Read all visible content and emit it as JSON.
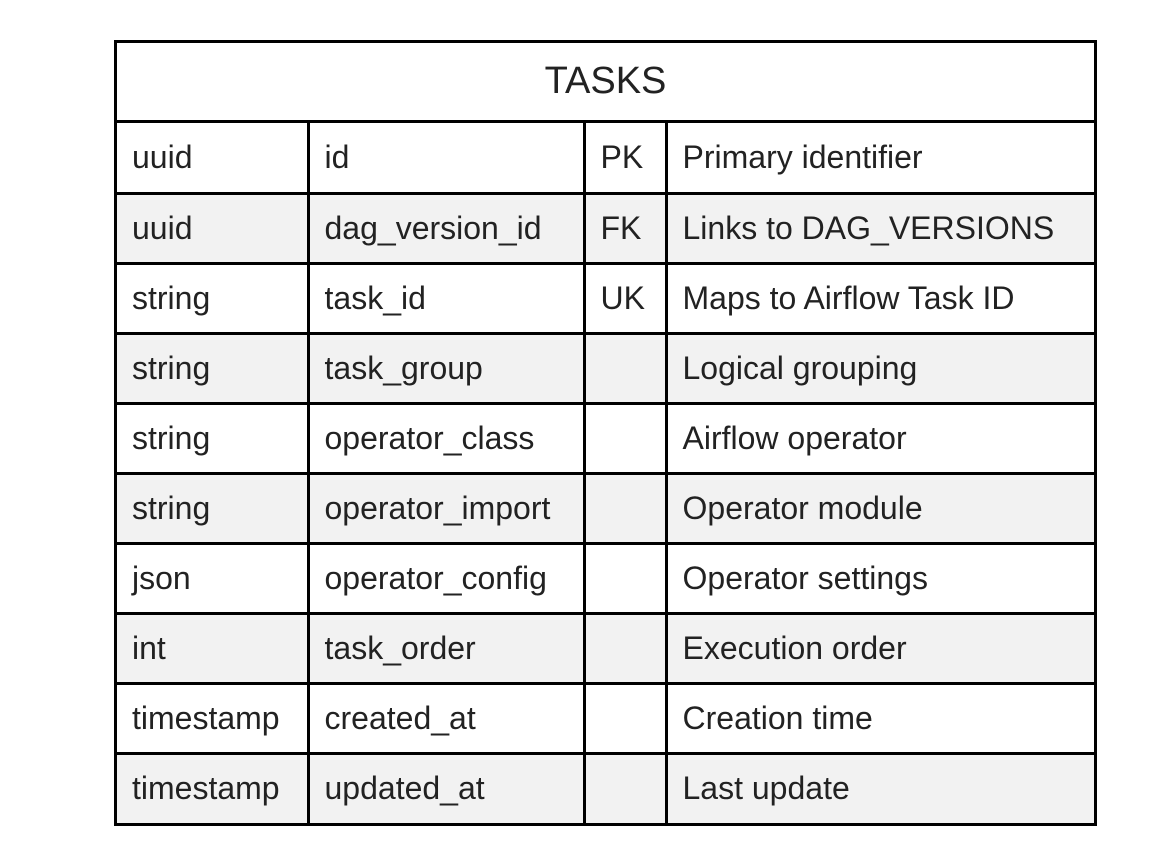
{
  "entity": {
    "name": "TASKS",
    "attributes": [
      {
        "type": "uuid",
        "name": "id",
        "key": "PK",
        "description": "Primary identifier"
      },
      {
        "type": "uuid",
        "name": "dag_version_id",
        "key": "FK",
        "description": "Links to DAG_VERSIONS"
      },
      {
        "type": "string",
        "name": "task_id",
        "key": "UK",
        "description": "Maps to Airflow Task ID"
      },
      {
        "type": "string",
        "name": "task_group",
        "key": "",
        "description": "Logical grouping"
      },
      {
        "type": "string",
        "name": "operator_class",
        "key": "",
        "description": "Airflow operator"
      },
      {
        "type": "string",
        "name": "operator_import",
        "key": "",
        "description": "Operator module"
      },
      {
        "type": "json",
        "name": "operator_config",
        "key": "",
        "description": "Operator settings"
      },
      {
        "type": "int",
        "name": "task_order",
        "key": "",
        "description": "Execution order"
      },
      {
        "type": "timestamp",
        "name": "created_at",
        "key": "",
        "description": "Creation time"
      },
      {
        "type": "timestamp",
        "name": "updated_at",
        "key": "",
        "description": "Last update"
      }
    ]
  }
}
